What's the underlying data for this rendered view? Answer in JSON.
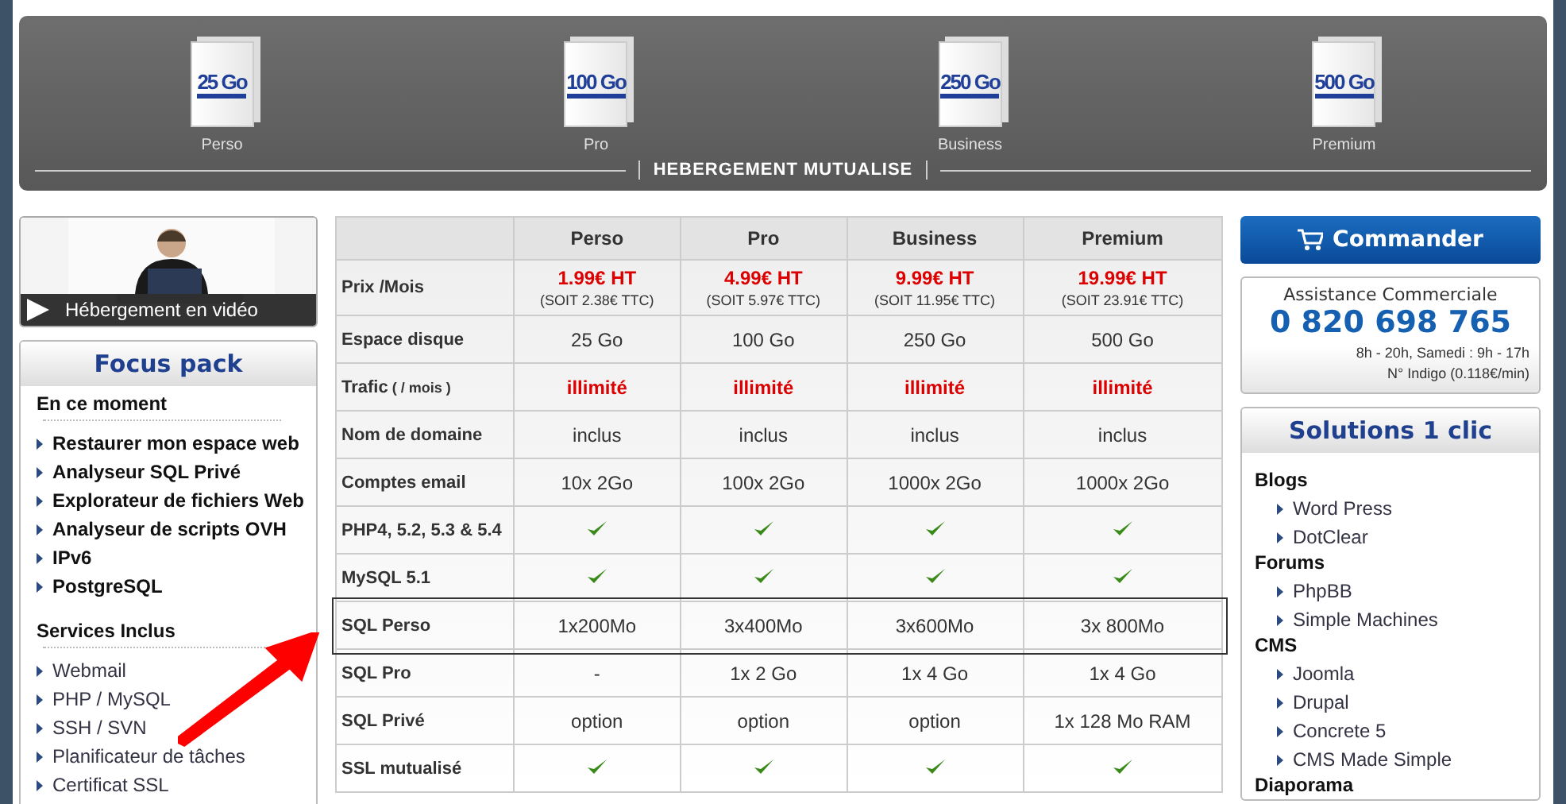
{
  "banner": {
    "title": "HEBERGEMENT MUTUALISE",
    "products": [
      {
        "box_label": "25 Go",
        "name": "Perso"
      },
      {
        "box_label": "100 Go",
        "name": "Pro"
      },
      {
        "box_label": "250 Go",
        "name": "Business"
      },
      {
        "box_label": "500 Go",
        "name": "Premium"
      }
    ]
  },
  "video": {
    "caption": "Hébergement en vidéo"
  },
  "focus_pack": {
    "title": "Focus pack",
    "sections": [
      {
        "heading": "En ce moment",
        "kind": "featured",
        "items": [
          "Restaurer mon espace web",
          "Analyseur SQL Privé",
          "Explorateur de fichiers Web",
          "Analyseur de scripts OVH",
          "IPv6",
          "PostgreSQL"
        ]
      },
      {
        "heading": "Services Inclus",
        "kind": "included",
        "items": [
          "Webmail",
          "PHP / MySQL",
          "SSH / SVN",
          "Planificateur de tâches",
          "Certificat SSL"
        ]
      }
    ]
  },
  "table": {
    "columns": [
      "Perso",
      "Pro",
      "Business",
      "Premium"
    ],
    "rows": [
      {
        "label": "Prix /Mois",
        "highlighted": false,
        "cells": [
          {
            "kind": "price",
            "text": "1.99€ HT",
            "note": "(SOIT 2.38€ TTC)"
          },
          {
            "kind": "price",
            "text": "4.99€ HT",
            "note": "(SOIT 5.97€ TTC)"
          },
          {
            "kind": "price",
            "text": "9.99€ HT",
            "note": "(SOIT 11.95€ TTC)"
          },
          {
            "kind": "price",
            "text": "19.99€ HT",
            "note": "(SOIT 23.91€ TTC)"
          }
        ]
      },
      {
        "label": "Espace disque",
        "highlighted": false,
        "cells": [
          {
            "kind": "text",
            "text": "25 Go"
          },
          {
            "kind": "text",
            "text": "100 Go"
          },
          {
            "kind": "text",
            "text": "250 Go"
          },
          {
            "kind": "text",
            "text": "500 Go"
          }
        ]
      },
      {
        "label": "Trafic",
        "label_note": "( / mois )",
        "highlighted": false,
        "cells": [
          {
            "kind": "strong",
            "text": "illimité"
          },
          {
            "kind": "strong",
            "text": "illimité"
          },
          {
            "kind": "strong",
            "text": "illimité"
          },
          {
            "kind": "strong",
            "text": "illimité"
          }
        ]
      },
      {
        "label": "Nom de domaine",
        "highlighted": false,
        "cells": [
          {
            "kind": "text",
            "text": "inclus"
          },
          {
            "kind": "text",
            "text": "inclus"
          },
          {
            "kind": "text",
            "text": "inclus"
          },
          {
            "kind": "text",
            "text": "inclus"
          }
        ]
      },
      {
        "label": "Comptes email",
        "highlighted": false,
        "cells": [
          {
            "kind": "text",
            "text": "10x 2Go"
          },
          {
            "kind": "text",
            "text": "100x 2Go"
          },
          {
            "kind": "text",
            "text": "1000x 2Go"
          },
          {
            "kind": "text",
            "text": "1000x 2Go"
          }
        ]
      },
      {
        "label": "PHP4, 5.2, 5.3 & 5.4",
        "highlighted": false,
        "cells": [
          {
            "kind": "check"
          },
          {
            "kind": "check"
          },
          {
            "kind": "check"
          },
          {
            "kind": "check"
          }
        ]
      },
      {
        "label": "MySQL 5.1",
        "highlighted": false,
        "cells": [
          {
            "kind": "check"
          },
          {
            "kind": "check"
          },
          {
            "kind": "check"
          },
          {
            "kind": "check"
          }
        ]
      },
      {
        "label": "SQL Perso",
        "highlighted": true,
        "cells": [
          {
            "kind": "text",
            "text": "1x200Mo"
          },
          {
            "kind": "text",
            "text": "3x400Mo"
          },
          {
            "kind": "text",
            "text": "3x600Mo"
          },
          {
            "kind": "text",
            "text": "3x 800Mo"
          }
        ]
      },
      {
        "label": "SQL Pro",
        "highlighted": false,
        "cells": [
          {
            "kind": "text",
            "text": "-"
          },
          {
            "kind": "text",
            "text": "1x 2 Go"
          },
          {
            "kind": "text",
            "text": "1x 4 Go"
          },
          {
            "kind": "text",
            "text": "1x 4 Go"
          }
        ]
      },
      {
        "label": "SQL Privé",
        "highlighted": false,
        "cells": [
          {
            "kind": "text",
            "text": "option"
          },
          {
            "kind": "text",
            "text": "option"
          },
          {
            "kind": "text",
            "text": "option"
          },
          {
            "kind": "text",
            "text": "1x 128 Mo RAM"
          }
        ]
      },
      {
        "label": "SSL mutualisé",
        "highlighted": false,
        "cells": [
          {
            "kind": "check"
          },
          {
            "kind": "check"
          },
          {
            "kind": "check"
          },
          {
            "kind": "check"
          }
        ]
      }
    ]
  },
  "order_button": "Commander",
  "assistance": {
    "title": "Assistance Commerciale",
    "phone": "0 820 698 765",
    "hours": "8h - 20h, Samedi : 9h - 17h",
    "rate": "N° Indigo (0.118€/min)"
  },
  "solutions": {
    "title": "Solutions 1 clic",
    "groups": [
      {
        "name": "Blogs",
        "items": [
          "Word Press",
          "DotClear"
        ]
      },
      {
        "name": "Forums",
        "items": [
          "PhpBB",
          "Simple Machines"
        ]
      },
      {
        "name": "CMS",
        "items": [
          "Joomla",
          "Drupal",
          "Concrete 5",
          "CMS Made Simple"
        ]
      },
      {
        "name": "Diaporama"
      }
    ]
  }
}
